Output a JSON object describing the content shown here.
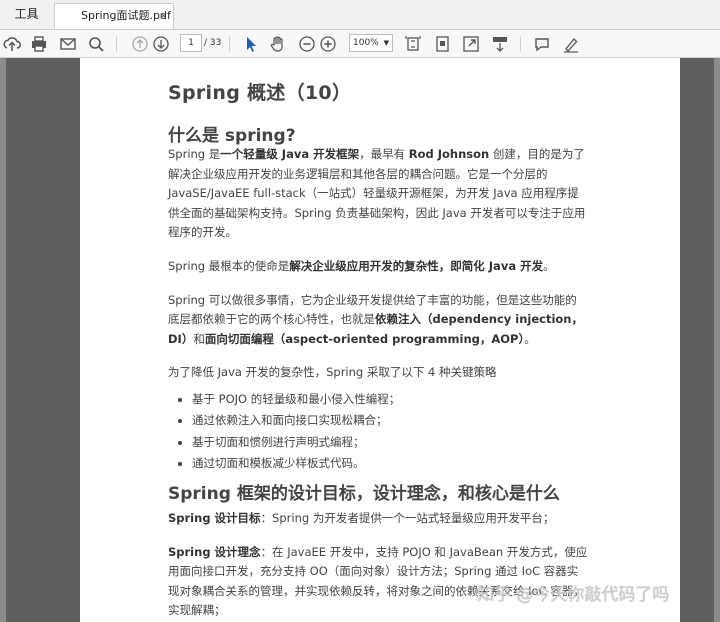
{
  "tabs": {
    "tools": "工具",
    "file": "Spring面试题.pdf",
    "close": "×"
  },
  "toolbar": {
    "page_current": "1",
    "page_total": "/ 33",
    "zoom": "100%"
  },
  "doc": {
    "title": "Spring 概述（10）",
    "h_what": "什么是 spring?",
    "p1": [
      {
        "t": "Spring 是"
      },
      {
        "t": "一个轻量级 Java 开发框架",
        "b": true
      },
      {
        "t": "，最早有 "
      },
      {
        "t": "Rod Johnson",
        "b": true
      },
      {
        "t": " 创建，目的是为了解决企业级应用开发的业务逻辑层和其他各层的耦合问题。它是一个分层的 JavaSE/JavaEE full-stack（一站式）轻量级开源框架，为开发 Java 应用程序提供全面的基础架构支持。Spring 负责基础架构，因此 Java 开发者可以专注于应用程序的开发。"
      }
    ],
    "p2": [
      {
        "t": "Spring 最根本的使命是"
      },
      {
        "t": "解决企业级应用开发的复杂性，即简化 Java 开发",
        "b": true
      },
      {
        "t": "。"
      }
    ],
    "p3": [
      {
        "t": "Spring 可以做很多事情，它为企业级开发提供给了丰富的功能，但是这些功能的底层都依赖于它的两个核心特性，也就是"
      },
      {
        "t": "依赖注入（dependency injection，DI）",
        "b": true
      },
      {
        "t": "和"
      },
      {
        "t": "面向切面编程（aspect-oriented programming，AOP）",
        "b": true
      },
      {
        "t": "。"
      }
    ],
    "p4": "为了降低 Java 开发的复杂性，Spring 采取了以下 4 种关键策略",
    "bullets": [
      "基于 POJO 的轻量级和最小侵入性编程；",
      "通过依赖注入和面向接口实现松耦合；",
      "基于切面和惯例进行声明式编程；",
      "通过切面和模板减少样板式代码。"
    ],
    "h_goal": "Spring 框架的设计目标，设计理念，和核心是什么",
    "p5": [
      {
        "t": "Spring 设计目标",
        "b": true
      },
      {
        "t": "：Spring 为开发者提供一个一站式轻量级应用开发平台；"
      }
    ],
    "p6": [
      {
        "t": "Spring 设计理念",
        "b": true
      },
      {
        "t": "：在 JavaEE 开发中，支持 POJO 和 JavaBean 开发方式，使应用面向接口开发，充分支持 OO（面向对象）设计方法；Spring 通过 IoC 容器实现对象耦合关系的管理，并实现依赖反转，将对象之间的依赖关系交给 IoC 容器，实现解耦；"
      }
    ]
  },
  "watermark": "知乎 @今天你敲代码了吗"
}
